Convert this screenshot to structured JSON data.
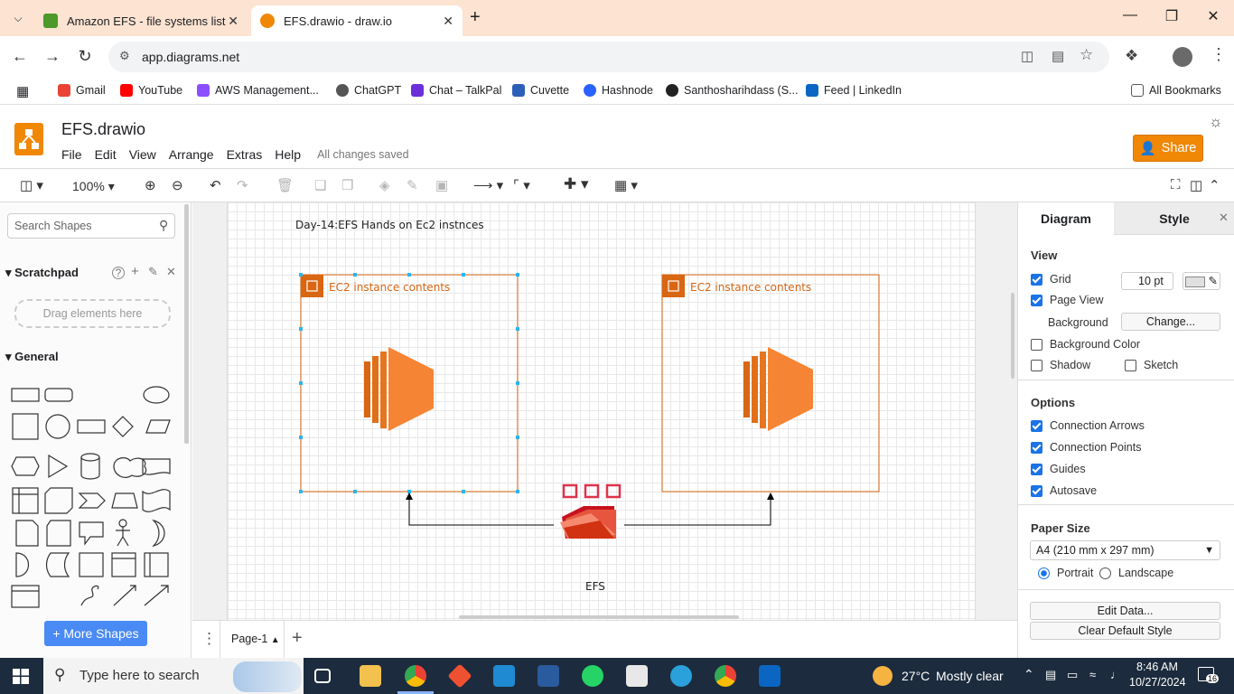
{
  "browser": {
    "tabs": [
      {
        "title": "Amazon EFS - file systems list",
        "active": false
      },
      {
        "title": "EFS.drawio - draw.io",
        "active": true
      }
    ],
    "new_tab": "+",
    "url": "app.diagrams.net",
    "bookmarks": [
      "Gmail",
      "YouTube",
      "AWS Management...",
      "ChatGPT",
      "Chat – TalkPal",
      "Cuvette",
      "Hashnode",
      "Santhosharihdass (S...",
      "Feed | LinkedIn"
    ],
    "all_bookmarks": "All Bookmarks"
  },
  "app": {
    "file_title": "EFS.drawio",
    "menu": [
      "File",
      "Edit",
      "View",
      "Arrange",
      "Extras",
      "Help"
    ],
    "saved_status": "All changes saved",
    "share_label": "Share",
    "zoom": "100%"
  },
  "left_panel": {
    "search_placeholder": "Search Shapes",
    "scratchpad": "Scratchpad",
    "drag_hint": "Drag elements here",
    "general": "General",
    "more_shapes": "+ More Shapes"
  },
  "diagram": {
    "title": "Day-14:EFS Hands on Ec2 instnces",
    "group1_label": "EC2 instance contents",
    "group2_label": "EC2 instance contents",
    "efs_label": "EFS"
  },
  "page_tab": "Page-1",
  "right_panel": {
    "tabs": [
      "Diagram",
      "Style"
    ],
    "view_header": "View",
    "grid": "Grid",
    "grid_size": "10 pt",
    "page_view": "Page View",
    "background": "Background",
    "change_btn": "Change...",
    "bg_color": "Background Color",
    "shadow": "Shadow",
    "sketch": "Sketch",
    "options_header": "Options",
    "options": [
      "Connection Arrows",
      "Connection Points",
      "Guides",
      "Autosave"
    ],
    "paper_header": "Paper Size",
    "paper_value": "A4 (210 mm x 297 mm)",
    "portrait": "Portrait",
    "landscape": "Landscape",
    "edit_data": "Edit Data...",
    "clear_style": "Clear Default Style"
  },
  "taskbar": {
    "search_placeholder": "Type here to search",
    "weather_temp": "27°C",
    "weather_desc": "Mostly clear",
    "time": "8:46 AM",
    "date": "10/27/2024",
    "notif_count": "16"
  }
}
